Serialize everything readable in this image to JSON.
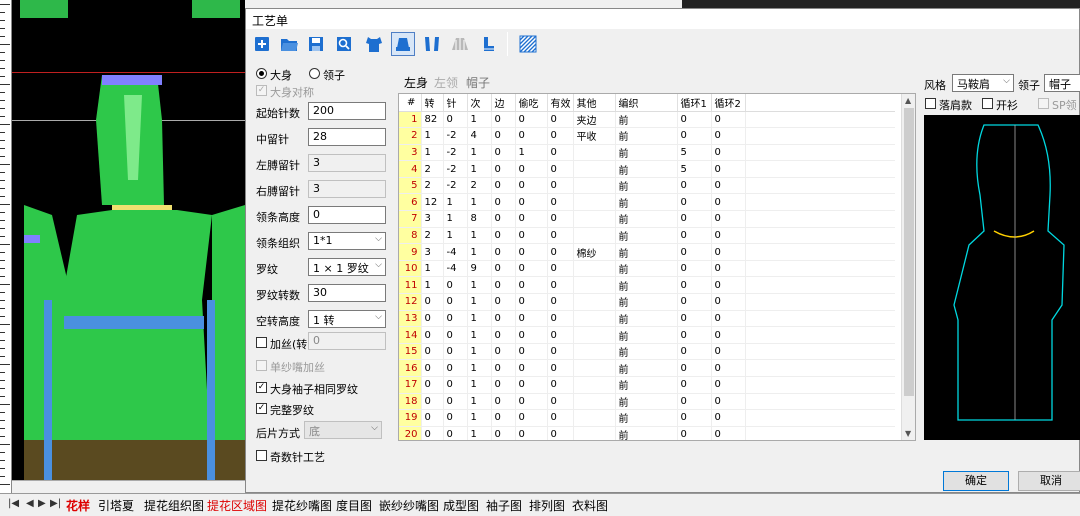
{
  "dialog": {
    "title": "工艺单"
  },
  "toolbar": {
    "buttons": [
      {
        "name": "new-icon"
      },
      {
        "name": "open-folder-icon"
      },
      {
        "name": "save-icon"
      },
      {
        "name": "preview-search-icon"
      },
      {
        "name": "body-shape-icon"
      },
      {
        "name": "collar-shape-icon"
      },
      {
        "name": "sleeves-shape-icon"
      },
      {
        "name": "knit-shape-icon"
      },
      {
        "name": "stitch-shape-icon"
      },
      {
        "name": "pattern-hatch-icon"
      }
    ]
  },
  "form": {
    "radio_body": "大身",
    "radio_collar": "领子",
    "body_symmetric": "大身对称",
    "start_needles_label": "起始针数",
    "start_needles": "200",
    "center_needles_label": "中留针",
    "center_needles": "28",
    "left_shoulder_label": "左膊留针",
    "left_shoulder": "3",
    "right_shoulder_label": "右膊留针",
    "right_shoulder": "3",
    "collar_height_label": "领条高度",
    "collar_height": "0",
    "collar_stitch_label": "领条组织",
    "collar_stitch": "1*1",
    "rib_label": "罗纹",
    "rib": "1 × 1 罗纹",
    "rib_rows_label": "罗纹转数",
    "rib_rows": "30",
    "empty_rows_label": "空转高度",
    "empty_rows": "1 转",
    "add_yarn_label": "加丝(转)",
    "add_yarn": "0",
    "single_feeder": "单纱嘴加丝",
    "same_rib": "大身袖子相同罗纹",
    "full_rib": "完整罗纹",
    "back_mode_label": "后片方式",
    "back_mode": "底",
    "odd_needle": "奇数针工艺"
  },
  "tabs": [
    "左身",
    "左领",
    "帽子"
  ],
  "table": {
    "headers": [
      "#",
      "转",
      "针",
      "次",
      "边",
      "偷吃",
      "有效",
      "其他",
      "编织",
      "循环1",
      "循环2"
    ],
    "rows": [
      [
        "1",
        "82",
        "0",
        "1",
        "0",
        "0",
        "0",
        "夹边",
        "前",
        "0",
        "0"
      ],
      [
        "2",
        "1",
        "-2",
        "4",
        "0",
        "0",
        "0",
        "平收",
        "前",
        "0",
        "0"
      ],
      [
        "3",
        "1",
        "-2",
        "1",
        "0",
        "1",
        "0",
        "",
        "前",
        "5",
        "0"
      ],
      [
        "4",
        "2",
        "-2",
        "1",
        "0",
        "0",
        "0",
        "",
        "前",
        "5",
        "0"
      ],
      [
        "5",
        "2",
        "-2",
        "2",
        "0",
        "0",
        "0",
        "",
        "前",
        "0",
        "0"
      ],
      [
        "6",
        "12",
        "1",
        "1",
        "0",
        "0",
        "0",
        "",
        "前",
        "0",
        "0"
      ],
      [
        "7",
        "3",
        "1",
        "8",
        "0",
        "0",
        "0",
        "",
        "前",
        "0",
        "0"
      ],
      [
        "8",
        "2",
        "1",
        "1",
        "0",
        "0",
        "0",
        "",
        "前",
        "0",
        "0"
      ],
      [
        "9",
        "3",
        "-4",
        "1",
        "0",
        "0",
        "0",
        "棉纱",
        "前",
        "0",
        "0"
      ],
      [
        "10",
        "1",
        "-4",
        "9",
        "0",
        "0",
        "0",
        "",
        "前",
        "0",
        "0"
      ],
      [
        "11",
        "1",
        "0",
        "1",
        "0",
        "0",
        "0",
        "",
        "前",
        "0",
        "0"
      ],
      [
        "12",
        "0",
        "0",
        "1",
        "0",
        "0",
        "0",
        "",
        "前",
        "0",
        "0"
      ],
      [
        "13",
        "0",
        "0",
        "1",
        "0",
        "0",
        "0",
        "",
        "前",
        "0",
        "0"
      ],
      [
        "14",
        "0",
        "0",
        "1",
        "0",
        "0",
        "0",
        "",
        "前",
        "0",
        "0"
      ],
      [
        "15",
        "0",
        "0",
        "1",
        "0",
        "0",
        "0",
        "",
        "前",
        "0",
        "0"
      ],
      [
        "16",
        "0",
        "0",
        "1",
        "0",
        "0",
        "0",
        "",
        "前",
        "0",
        "0"
      ],
      [
        "17",
        "0",
        "0",
        "1",
        "0",
        "0",
        "0",
        "",
        "前",
        "0",
        "0"
      ],
      [
        "18",
        "0",
        "0",
        "1",
        "0",
        "0",
        "0",
        "",
        "前",
        "0",
        "0"
      ],
      [
        "19",
        "0",
        "0",
        "1",
        "0",
        "0",
        "0",
        "",
        "前",
        "0",
        "0"
      ],
      [
        "20",
        "0",
        "0",
        "1",
        "0",
        "0",
        "0",
        "",
        "前",
        "0",
        "0"
      ]
    ]
  },
  "right": {
    "style_label": "风格",
    "style": "马鞍肩",
    "collar_label": "领子",
    "collar": "帽子",
    "drop_shoulder": "落肩款",
    "cardigan": "开衫",
    "sp_collar": "SP领"
  },
  "buttons": {
    "ok": "确定",
    "cancel": "取消"
  },
  "sheet_tabs": [
    "花样",
    "引塔夏",
    "提花组织图",
    "提花区域图",
    "提花纱嘴图",
    "度目图",
    "嵌纱纱嘴图",
    "成型图",
    "袖子图",
    "排列图",
    "衣料图"
  ],
  "colors": {
    "accent": "#1e6fd0",
    "preview_outline": "#00d8e0",
    "row_number_bg": "#ffffa0"
  }
}
